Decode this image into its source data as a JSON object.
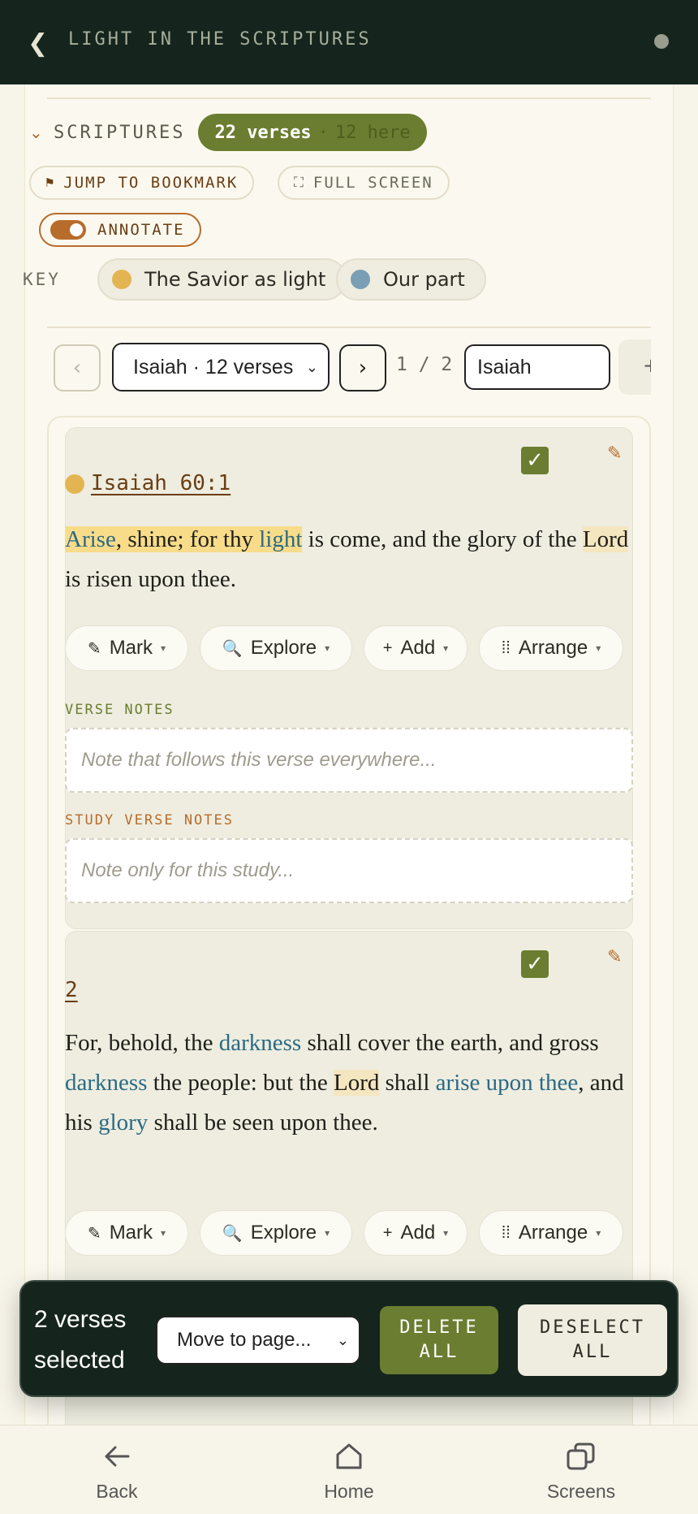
{
  "header": {
    "back_glyph": "❮",
    "title": "LIGHT IN THE SCRIPTURES"
  },
  "section": {
    "chevron": "⌄",
    "title": "SCRIPTURES",
    "count_main": "22 verses",
    "count_sep": "·",
    "count_here": "12 here"
  },
  "toolbar": {
    "jump_icon": "⚑",
    "jump_label": "JUMP TO BOOKMARK",
    "full_icon": "⛶",
    "full_label": "FULL SCREEN",
    "annotate_label": "ANNOTATE",
    "annotate_on": true
  },
  "key": {
    "label": "KEY",
    "items": [
      {
        "label": "The Savior as light",
        "color": "#e3b552"
      },
      {
        "label": "Our part",
        "color": "#7a9fb5"
      }
    ]
  },
  "pager": {
    "prev": "‹",
    "next": "›",
    "selected_page": "Isaiah · 12 verses",
    "count": "1 / 2",
    "name_value": "Isaiah",
    "add": "+"
  },
  "verses": [
    {
      "ref": "Isaiah 60:1",
      "checked": true,
      "segments": [
        "Arise",
        ", shine; for thy ",
        "light",
        " is come, and the glory of the ",
        "Lord",
        " is risen upon thee."
      ]
    },
    {
      "ref": "2",
      "checked": true,
      "segments": [
        "For, behold, the ",
        "darkness",
        " shall cover the earth, and gross ",
        "darkness",
        " the people: but the ",
        "Lord",
        " shall ",
        "arise upon thee",
        ", and his ",
        "glory",
        " shall be seen upon thee."
      ]
    }
  ],
  "actions": {
    "mark": "Mark",
    "explore": "Explore",
    "add": "Add",
    "arrange": "Arrange",
    "caret": "▾",
    "mark_icon": "✎",
    "add_icon": "+",
    "arrange_icon": "⁞⁞"
  },
  "notes": {
    "verse_label": "VERSE NOTES",
    "verse_placeholder": "Note that follows this verse everywhere...",
    "study_label": "STUDY VERSE NOTES",
    "study_placeholder": "Note only for this study..."
  },
  "selection": {
    "text": "2 verses selected",
    "move_label": "Move to page...",
    "delete_label": "DELETE ALL",
    "deselect_label": "DESELECT ALL"
  },
  "nav": {
    "back": "Back",
    "home": "Home",
    "screens": "Screens"
  },
  "colors": {
    "accent_green": "#6b7d30",
    "accent_orange": "#b86c2c",
    "dark_bar": "#15251d"
  }
}
